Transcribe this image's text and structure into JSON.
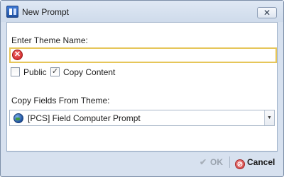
{
  "window": {
    "title": "New Prompt",
    "close_glyph": "✕"
  },
  "form": {
    "theme_name_label": "Enter Theme Name:",
    "theme_name_value": "",
    "error_icon_glyph": "✕",
    "public_label": "Public",
    "public_checked": false,
    "copy_content_label": "Copy Content",
    "copy_content_checked": true,
    "check_glyph": "✓",
    "copy_fields_label": "Copy Fields From Theme:",
    "copy_fields_selected": "[PCS] Field Computer Prompt",
    "dropdown_glyph": "▼"
  },
  "buttons": {
    "ok_label": "OK",
    "ok_glyph": "✔",
    "ok_enabled": false,
    "cancel_label": "Cancel",
    "cancel_glyph": "⊘"
  },
  "colors": {
    "input_highlight_border": "#e6c65a",
    "error_red": "#c81e1e",
    "window_frame": "#d7e1ef"
  }
}
